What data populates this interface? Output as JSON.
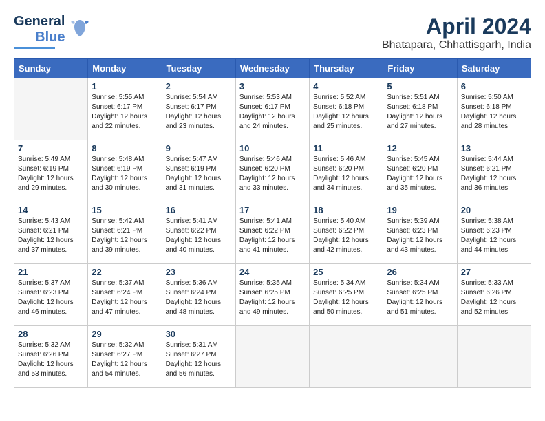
{
  "logo": {
    "line1": "General",
    "line2": "Blue"
  },
  "title": "April 2024",
  "location": "Bhatapara, Chhattisgarh, India",
  "days_of_week": [
    "Sunday",
    "Monday",
    "Tuesday",
    "Wednesday",
    "Thursday",
    "Friday",
    "Saturday"
  ],
  "weeks": [
    [
      {
        "day": "",
        "info": ""
      },
      {
        "day": "1",
        "info": "Sunrise: 5:55 AM\nSunset: 6:17 PM\nDaylight: 12 hours\nand 22 minutes."
      },
      {
        "day": "2",
        "info": "Sunrise: 5:54 AM\nSunset: 6:17 PM\nDaylight: 12 hours\nand 23 minutes."
      },
      {
        "day": "3",
        "info": "Sunrise: 5:53 AM\nSunset: 6:17 PM\nDaylight: 12 hours\nand 24 minutes."
      },
      {
        "day": "4",
        "info": "Sunrise: 5:52 AM\nSunset: 6:18 PM\nDaylight: 12 hours\nand 25 minutes."
      },
      {
        "day": "5",
        "info": "Sunrise: 5:51 AM\nSunset: 6:18 PM\nDaylight: 12 hours\nand 27 minutes."
      },
      {
        "day": "6",
        "info": "Sunrise: 5:50 AM\nSunset: 6:18 PM\nDaylight: 12 hours\nand 28 minutes."
      }
    ],
    [
      {
        "day": "7",
        "info": "Sunrise: 5:49 AM\nSunset: 6:19 PM\nDaylight: 12 hours\nand 29 minutes."
      },
      {
        "day": "8",
        "info": "Sunrise: 5:48 AM\nSunset: 6:19 PM\nDaylight: 12 hours\nand 30 minutes."
      },
      {
        "day": "9",
        "info": "Sunrise: 5:47 AM\nSunset: 6:19 PM\nDaylight: 12 hours\nand 31 minutes."
      },
      {
        "day": "10",
        "info": "Sunrise: 5:46 AM\nSunset: 6:20 PM\nDaylight: 12 hours\nand 33 minutes."
      },
      {
        "day": "11",
        "info": "Sunrise: 5:46 AM\nSunset: 6:20 PM\nDaylight: 12 hours\nand 34 minutes."
      },
      {
        "day": "12",
        "info": "Sunrise: 5:45 AM\nSunset: 6:20 PM\nDaylight: 12 hours\nand 35 minutes."
      },
      {
        "day": "13",
        "info": "Sunrise: 5:44 AM\nSunset: 6:21 PM\nDaylight: 12 hours\nand 36 minutes."
      }
    ],
    [
      {
        "day": "14",
        "info": "Sunrise: 5:43 AM\nSunset: 6:21 PM\nDaylight: 12 hours\nand 37 minutes."
      },
      {
        "day": "15",
        "info": "Sunrise: 5:42 AM\nSunset: 6:21 PM\nDaylight: 12 hours\nand 39 minutes."
      },
      {
        "day": "16",
        "info": "Sunrise: 5:41 AM\nSunset: 6:22 PM\nDaylight: 12 hours\nand 40 minutes."
      },
      {
        "day": "17",
        "info": "Sunrise: 5:41 AM\nSunset: 6:22 PM\nDaylight: 12 hours\nand 41 minutes."
      },
      {
        "day": "18",
        "info": "Sunrise: 5:40 AM\nSunset: 6:22 PM\nDaylight: 12 hours\nand 42 minutes."
      },
      {
        "day": "19",
        "info": "Sunrise: 5:39 AM\nSunset: 6:23 PM\nDaylight: 12 hours\nand 43 minutes."
      },
      {
        "day": "20",
        "info": "Sunrise: 5:38 AM\nSunset: 6:23 PM\nDaylight: 12 hours\nand 44 minutes."
      }
    ],
    [
      {
        "day": "21",
        "info": "Sunrise: 5:37 AM\nSunset: 6:23 PM\nDaylight: 12 hours\nand 46 minutes."
      },
      {
        "day": "22",
        "info": "Sunrise: 5:37 AM\nSunset: 6:24 PM\nDaylight: 12 hours\nand 47 minutes."
      },
      {
        "day": "23",
        "info": "Sunrise: 5:36 AM\nSunset: 6:24 PM\nDaylight: 12 hours\nand 48 minutes."
      },
      {
        "day": "24",
        "info": "Sunrise: 5:35 AM\nSunset: 6:25 PM\nDaylight: 12 hours\nand 49 minutes."
      },
      {
        "day": "25",
        "info": "Sunrise: 5:34 AM\nSunset: 6:25 PM\nDaylight: 12 hours\nand 50 minutes."
      },
      {
        "day": "26",
        "info": "Sunrise: 5:34 AM\nSunset: 6:25 PM\nDaylight: 12 hours\nand 51 minutes."
      },
      {
        "day": "27",
        "info": "Sunrise: 5:33 AM\nSunset: 6:26 PM\nDaylight: 12 hours\nand 52 minutes."
      }
    ],
    [
      {
        "day": "28",
        "info": "Sunrise: 5:32 AM\nSunset: 6:26 PM\nDaylight: 12 hours\nand 53 minutes."
      },
      {
        "day": "29",
        "info": "Sunrise: 5:32 AM\nSunset: 6:27 PM\nDaylight: 12 hours\nand 54 minutes."
      },
      {
        "day": "30",
        "info": "Sunrise: 5:31 AM\nSunset: 6:27 PM\nDaylight: 12 hours\nand 56 minutes."
      },
      {
        "day": "",
        "info": ""
      },
      {
        "day": "",
        "info": ""
      },
      {
        "day": "",
        "info": ""
      },
      {
        "day": "",
        "info": ""
      }
    ]
  ]
}
